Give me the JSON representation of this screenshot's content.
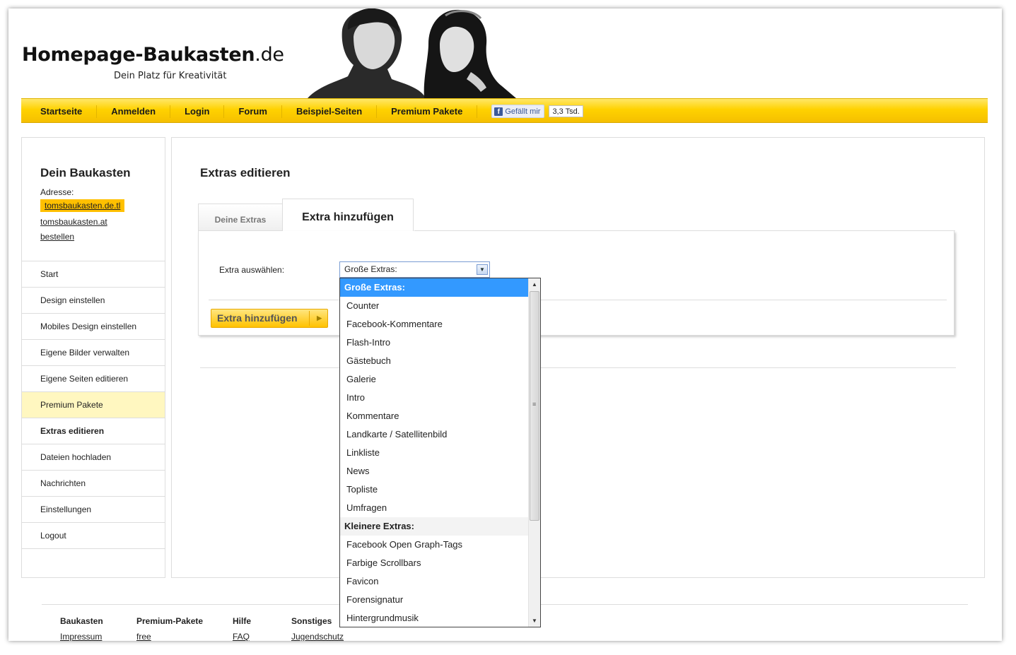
{
  "header": {
    "logo_main": "Homepage-Baukasten",
    "logo_tld": ".de",
    "tagline": "Dein Platz für Kreativität"
  },
  "nav": {
    "items": [
      "Startseite",
      "Anmelden",
      "Login",
      "Forum",
      "Beispiel-Seiten",
      "Premium Pakete"
    ],
    "like_label": "Gefällt mir",
    "like_count": "3,3 Tsd."
  },
  "sidebar": {
    "title": "Dein Baukasten",
    "address_label": "Adresse:",
    "address_primary": "tomsbaukasten.de.tl",
    "address_secondary": "tomsbaukasten.at",
    "order_link": "bestellen",
    "items": [
      "Start",
      "Design einstellen",
      "Mobiles Design einstellen",
      "Eigene Bilder verwalten",
      "Eigene Seiten editieren",
      "Premium Pakete",
      "Extras editieren",
      "Dateien hochladen",
      "Nachrichten",
      "Einstellungen",
      "Logout"
    ]
  },
  "main": {
    "title": "Extras editieren",
    "tabs": [
      "Deine Extras",
      "Extra hinzufügen"
    ],
    "select_label": "Extra auswählen:",
    "select_value": "Große Extras:",
    "submit_label": "Extra hinzufügen"
  },
  "dropdown": {
    "group1": "Große Extras:",
    "group1_options": [
      "Counter",
      "Facebook-Kommentare",
      "Flash-Intro",
      "Gästebuch",
      "Galerie",
      "Intro",
      "Kommentare",
      "Landkarte / Satellitenbild",
      "Linkliste",
      "News",
      "Topliste",
      "Umfragen"
    ],
    "group2": "Kleinere Extras:",
    "group2_options": [
      "Facebook Open Graph-Tags",
      "Farbige Scrollbars",
      "Favicon",
      "Forensignatur",
      "Hintergrundmusik"
    ]
  },
  "footer": {
    "columns": [
      {
        "heading": "Baukasten",
        "link": "Impressum"
      },
      {
        "heading": "Premium-Pakete",
        "link": "free"
      },
      {
        "heading": "Hilfe",
        "link": "FAQ"
      },
      {
        "heading": "Sonstiges",
        "link": "Jugendschutz"
      }
    ]
  },
  "colors": {
    "accent": "#ffc000",
    "nav_top": "#ffe768",
    "selection": "#3399ff",
    "highlight_row": "#fff7c0"
  }
}
